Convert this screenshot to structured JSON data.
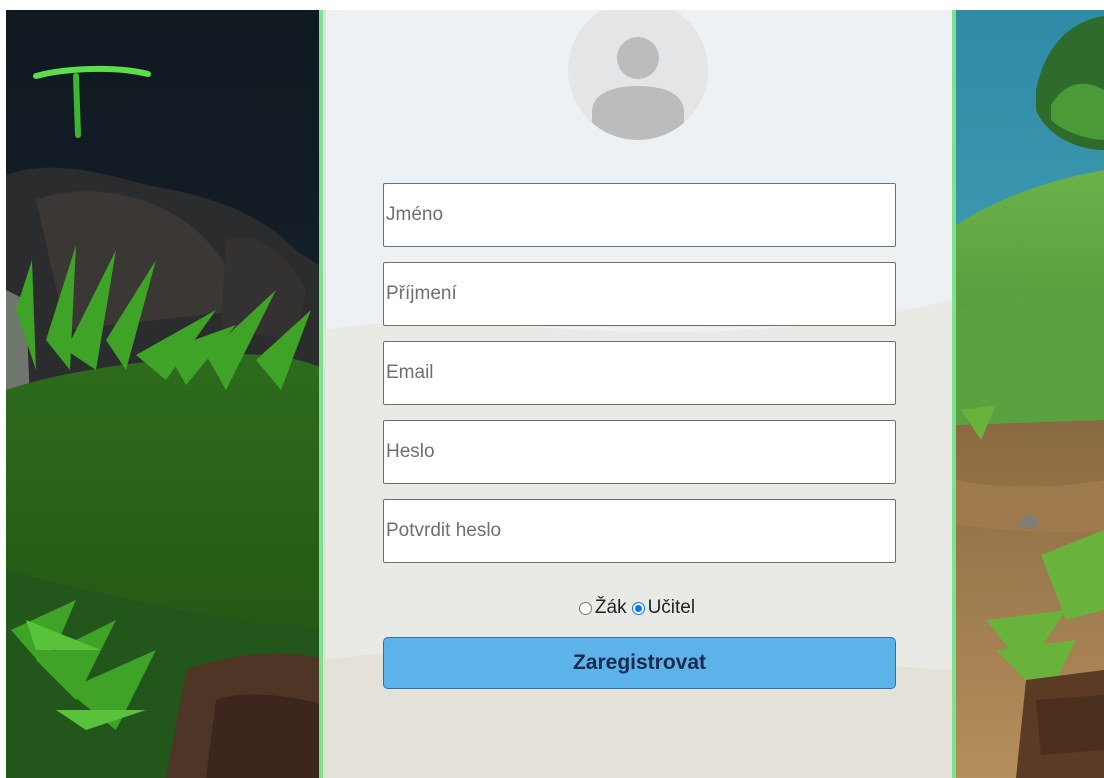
{
  "registration_form": {
    "avatar_icon": "user-silhouette-icon",
    "first_name": {
      "placeholder": "Jméno",
      "value": ""
    },
    "last_name": {
      "placeholder": "Příjmení",
      "value": ""
    },
    "email": {
      "placeholder": "Email",
      "value": ""
    },
    "password": {
      "placeholder": "Heslo",
      "value": ""
    },
    "confirm_password": {
      "placeholder": "Potvrdit heslo",
      "value": ""
    },
    "role": {
      "options": [
        {
          "label": "Žák",
          "checked": false
        },
        {
          "label": "Učitel",
          "checked": true
        }
      ]
    },
    "submit_label": "Zaregistrovat"
  },
  "colors": {
    "panel_border": "#7ce38a",
    "button_fill": "#5cb3ea",
    "button_text": "#1b2a4a",
    "radio_accent": "#0075ff"
  }
}
